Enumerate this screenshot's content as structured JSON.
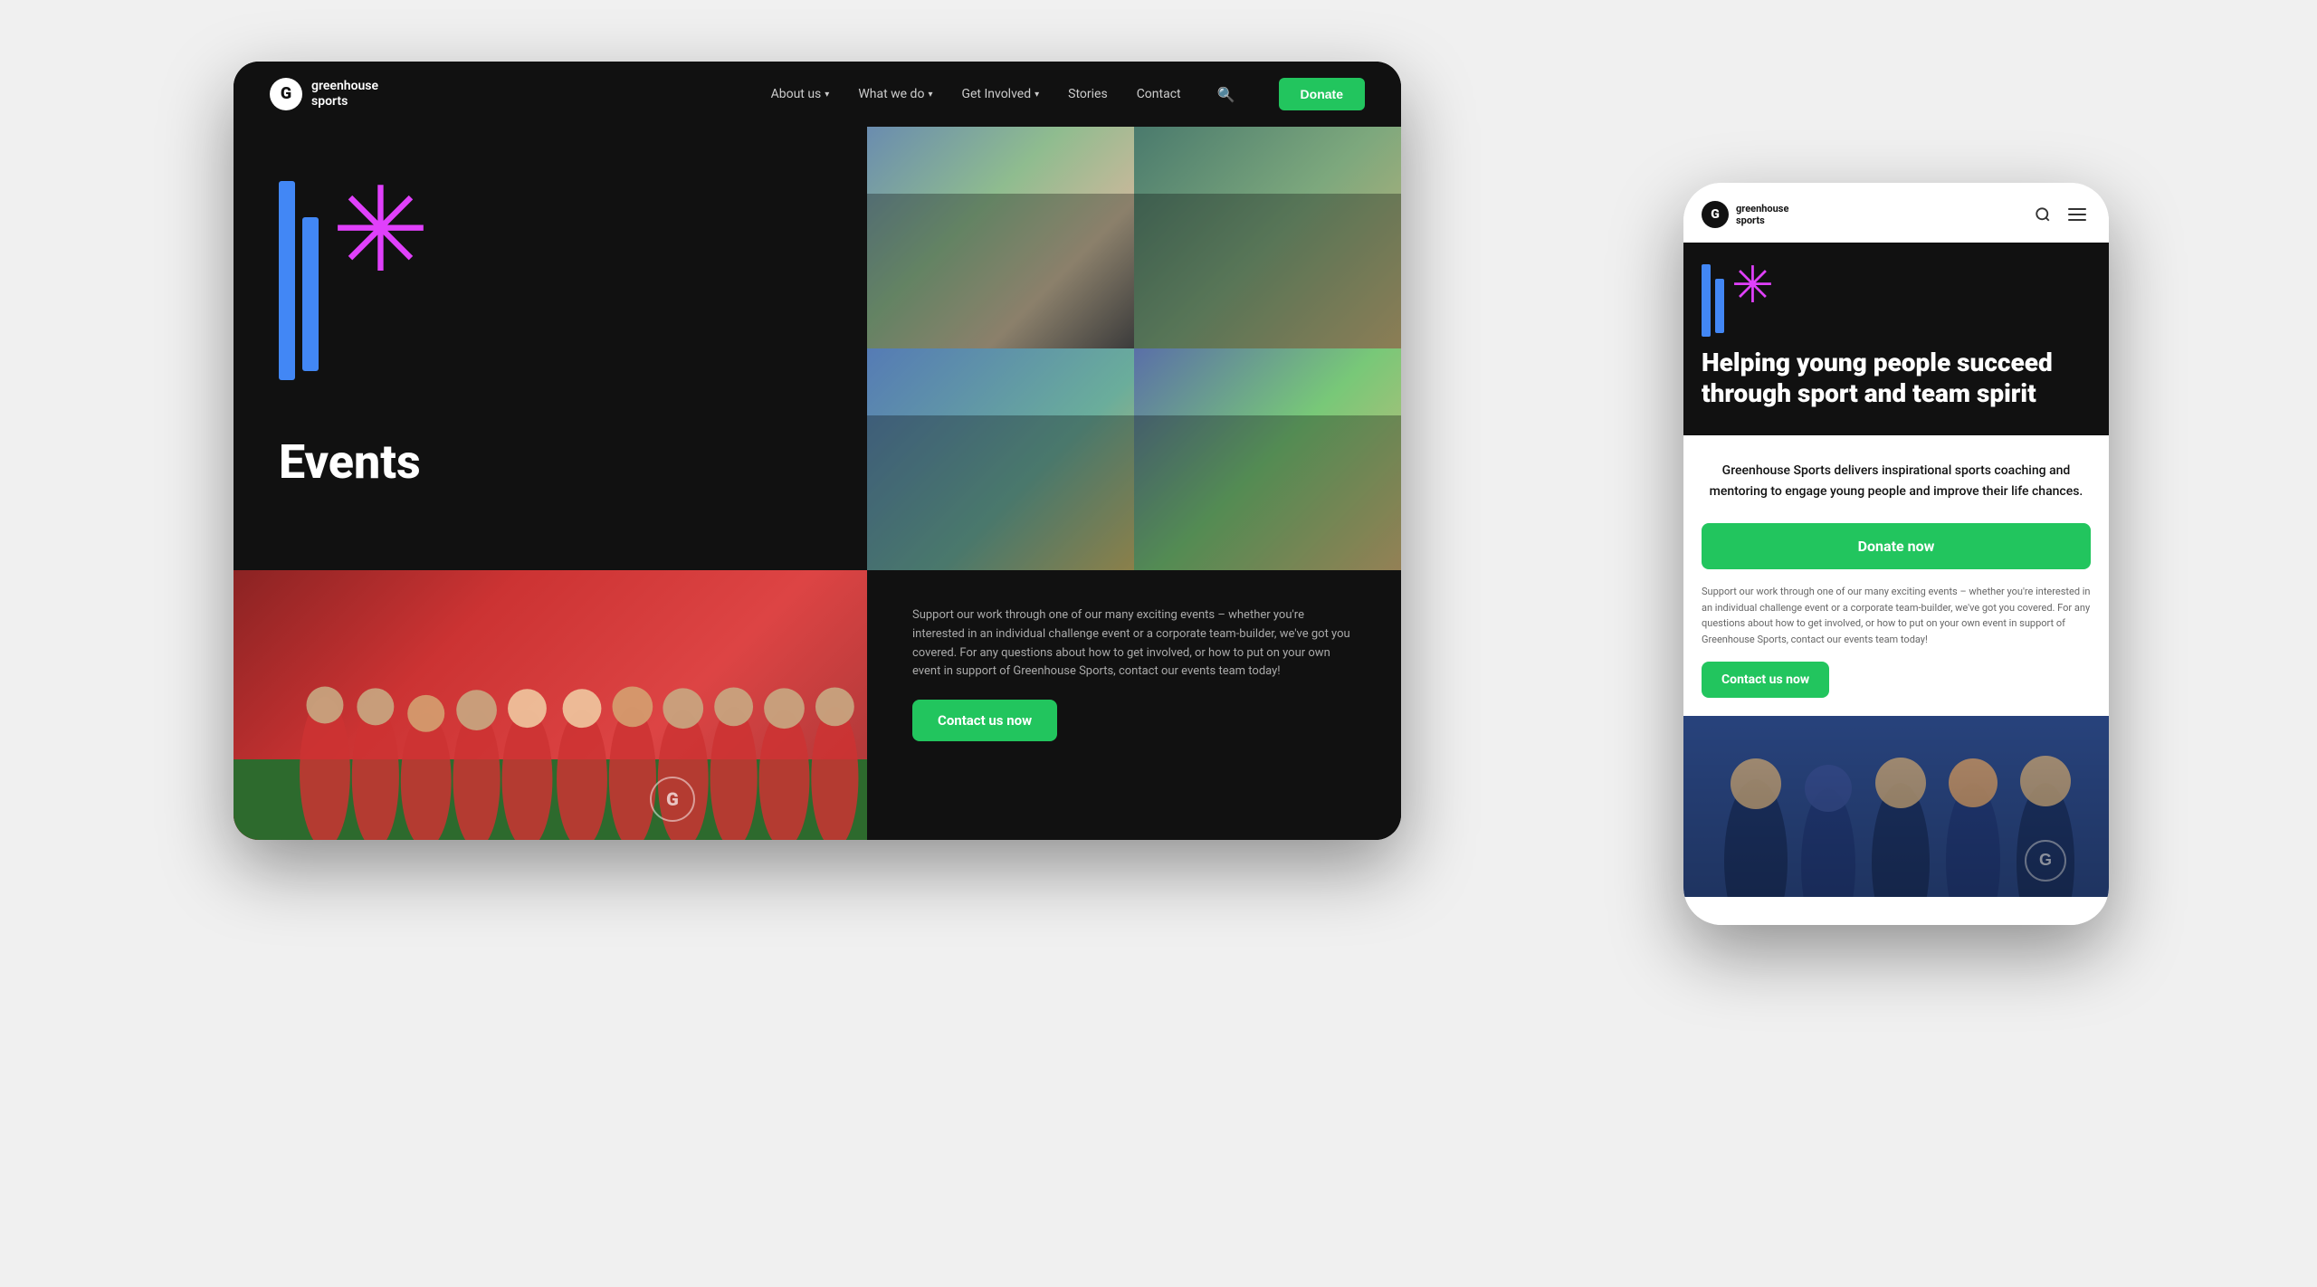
{
  "scene": {
    "bg_color": "#e8e8e8"
  },
  "tablet": {
    "nav": {
      "logo_letter": "G",
      "logo_name_line1": "greenhouse",
      "logo_name_line2": "sports",
      "links": [
        {
          "label": "About us",
          "has_arrow": true
        },
        {
          "label": "What we do",
          "has_arrow": true
        },
        {
          "label": "Get Involved",
          "has_arrow": true
        },
        {
          "label": "Stories",
          "has_arrow": false
        },
        {
          "label": "Contact",
          "has_arrow": false
        }
      ],
      "donate_label": "Donate"
    },
    "hero": {
      "page_title": "Events"
    },
    "bottom_text": "Support our work through one of our many exciting events – whether you're interested in an individual challenge event or a corporate team-builder, we've got you covered. For any questions about how to get involved, or how to put on your own event in support of Greenhouse Sports, contact our events team today!",
    "contact_btn_label": "Contact us now"
  },
  "mobile": {
    "nav": {
      "logo_letter": "G",
      "logo_name_line1": "greenhouse",
      "logo_name_line2": "sports"
    },
    "hero": {
      "headline": "Helping young people succeed through sport and team spirit"
    },
    "description": "Greenhouse Sports delivers inspirational sports coaching and mentoring to engage young people and improve their life chances.",
    "donate_btn_label": "Donate now",
    "body_text": "Support our work through one of our many exciting events – whether you're interested in an individual challenge event or a corporate team-builder, we've got you covered. For any questions about how to get involved, or how to put on your own event in support of Greenhouse Sports, contact our events team today!",
    "contact_btn_label": "Contact us now"
  }
}
